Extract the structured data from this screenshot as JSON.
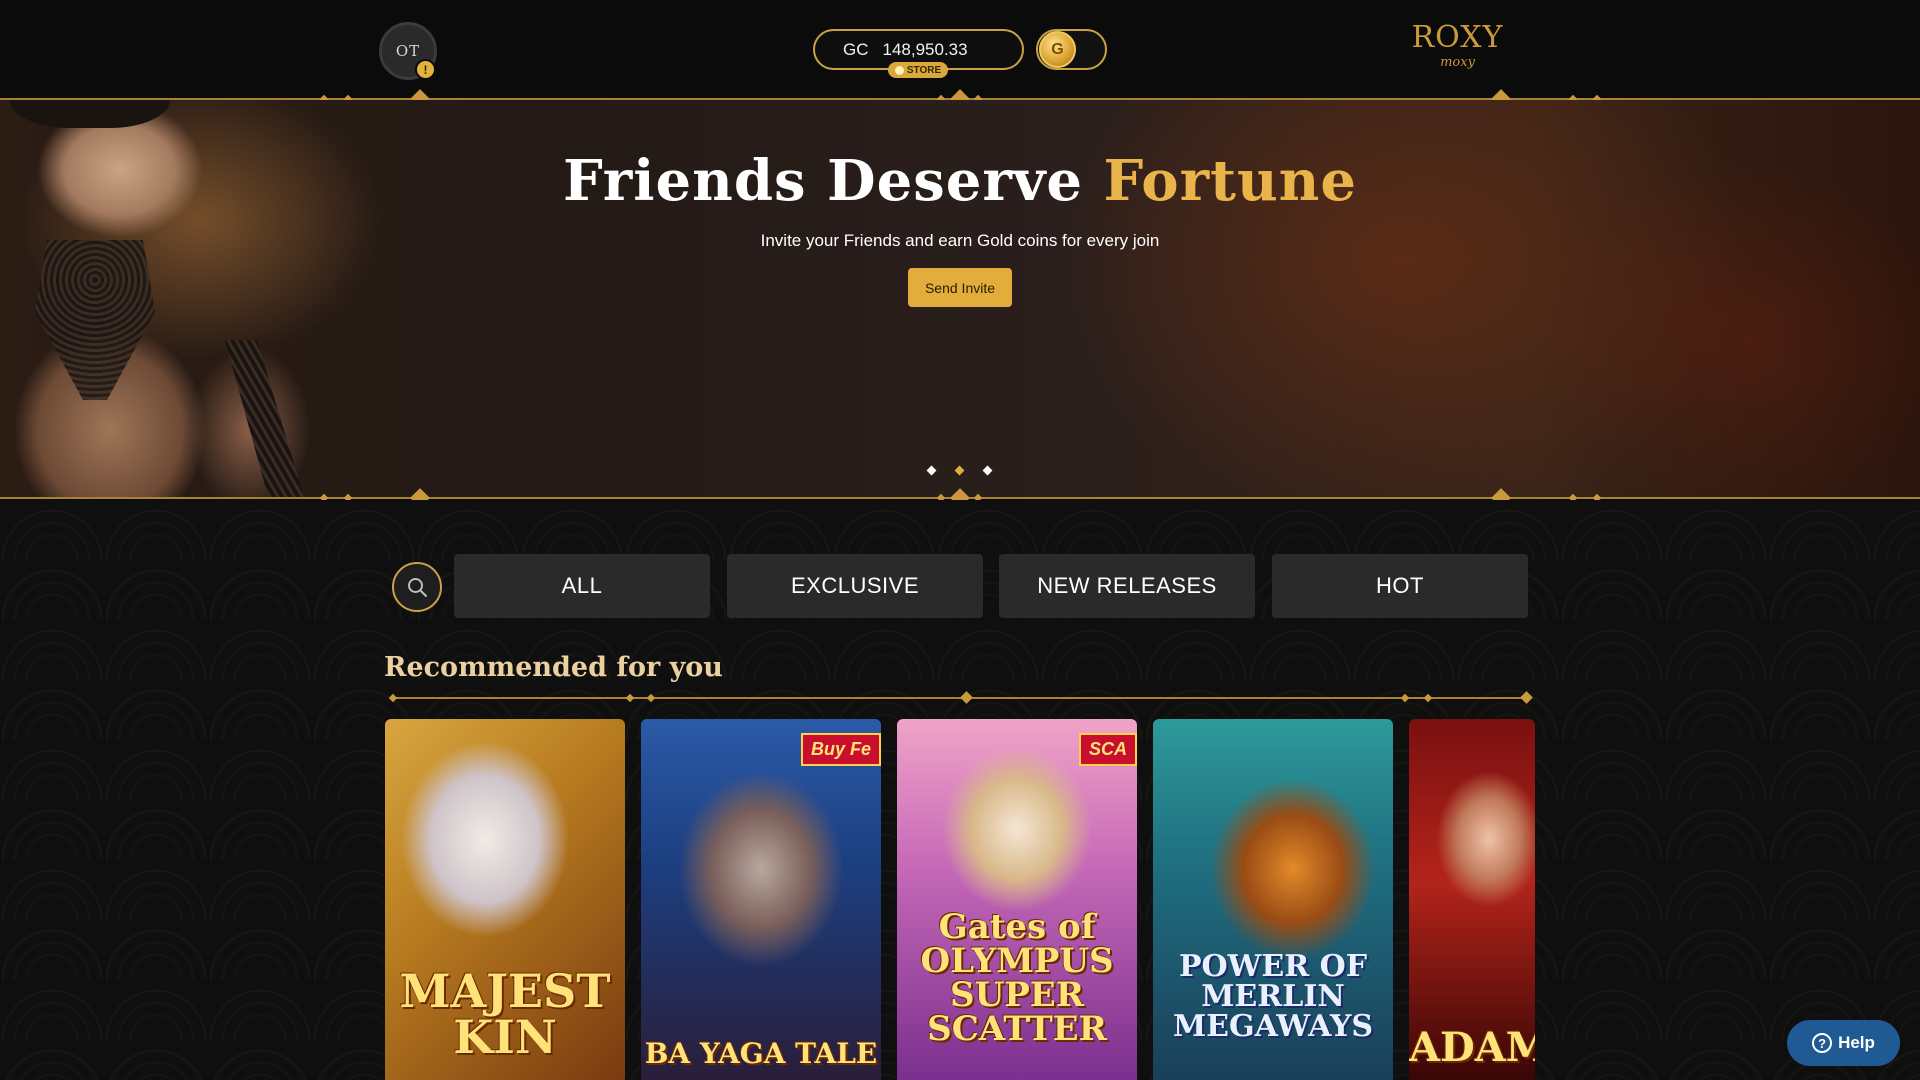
{
  "header": {
    "avatar_initials": "OT",
    "avatar_badge": "!",
    "balance_currency": "GC",
    "balance_value": "148,950.33",
    "store_label": "STORE",
    "toggle_coin_symbol": "G",
    "logo_top": "ROXY",
    "logo_sub": "moxy"
  },
  "hero": {
    "title_main": "Friends Deserve",
    "title_accent": "Fortune",
    "subtitle": "Invite your Friends and earn Gold coins for every join",
    "button_label": "Send Invite",
    "slides": 3,
    "active_slide": 2
  },
  "filters": {
    "tabs": [
      {
        "label": "ALL"
      },
      {
        "label": "EXCLUSIVE"
      },
      {
        "label": "NEW RELEASES"
      },
      {
        "label": "HOT"
      }
    ]
  },
  "section": {
    "title": "Recommended for you"
  },
  "games": [
    {
      "title": "MAJEST KIN",
      "ribbon": ""
    },
    {
      "title": "BA YAGA TALE",
      "ribbon": "Buy Fe"
    },
    {
      "title": "Gates of OLYMPUS SUPER SCATTER",
      "ribbon": "SCA"
    },
    {
      "title": "POWER OF MERLIN MEGAWAYS",
      "ribbon": ""
    },
    {
      "title": "ADAM",
      "ribbon": ""
    }
  ],
  "help": {
    "label": "Help",
    "icon_glyph": "?"
  },
  "colors": {
    "gold": "#c9a247",
    "accent": "#e3ad3c",
    "tab_bg": "#2a2a2b",
    "help_blue": "#1f5a94"
  },
  "icons": {
    "search": "search-icon",
    "help": "help-icon"
  }
}
